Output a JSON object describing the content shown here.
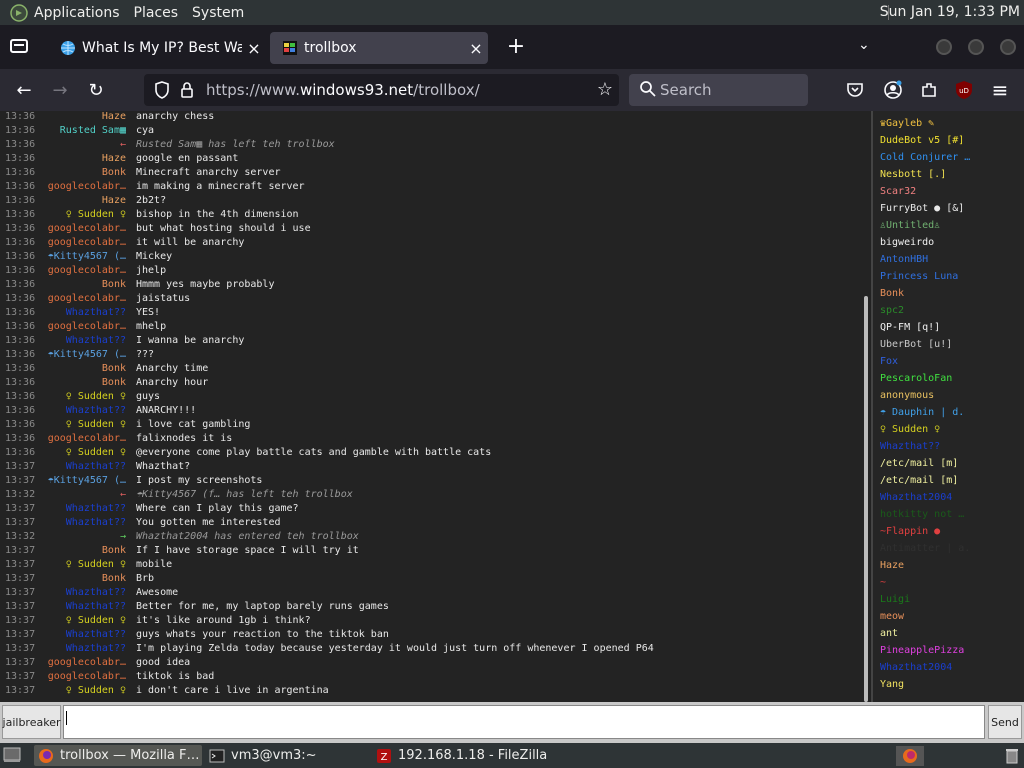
{
  "panel": {
    "menus": [
      "Applications",
      "Places",
      "System"
    ],
    "clock": "Sun Jan 19,  1:33 PM"
  },
  "tabs": [
    {
      "title": "What Is My IP? Best Way To",
      "close": "×"
    },
    {
      "title": "trollbox",
      "close": "×"
    }
  ],
  "newtab": "+",
  "alltabs": "⌄",
  "nav": {
    "back": "←",
    "forward": "→",
    "reload": "↻",
    "url_prefix": "https://www.",
    "url_domain": "windows93.net",
    "url_path": "/trollbox/",
    "search_placeholder": "Search",
    "menu": "≡"
  },
  "chat": {
    "messages": [
      {
        "time": "13:36",
        "nick": "Haze",
        "color": "#e8a060",
        "text": "anarchy chess"
      },
      {
        "time": "13:36",
        "nick": "Rusted Sam▦",
        "color": "#52d1c8",
        "text": "cya"
      },
      {
        "time": "13:36",
        "nick": "←",
        "color": "#e06060",
        "text": "Rusted Sam▦ has left teh trollbox",
        "sys": true
      },
      {
        "time": "13:36",
        "nick": "Haze",
        "color": "#e8a060",
        "text": "google en passant"
      },
      {
        "time": "13:36",
        "nick": "Bonk",
        "color": "#e8905a",
        "text": "Minecraft anarchy server"
      },
      {
        "time": "13:36",
        "nick": "googlecolabr…",
        "color": "#e07040",
        "text": "im making a minecraft server"
      },
      {
        "time": "13:36",
        "nick": "Haze",
        "color": "#e8a060",
        "text": "2b2t?"
      },
      {
        "time": "13:36",
        "nick": "♀ Sudden ♀",
        "color": "#d4d020",
        "text": "bishop in the 4th dimension"
      },
      {
        "time": "13:36",
        "nick": "googlecolabr…",
        "color": "#e07040",
        "text": "but what hosting should i use"
      },
      {
        "time": "13:36",
        "nick": "googlecolabr…",
        "color": "#e07040",
        "text": "it will be anarchy"
      },
      {
        "time": "13:36",
        "nick": "☂Kitty4567 (…",
        "color": "#5aa0e0",
        "text": "Mickey"
      },
      {
        "time": "13:36",
        "nick": "googlecolabr…",
        "color": "#e07040",
        "text": "jhelp"
      },
      {
        "time": "13:36",
        "nick": "Bonk",
        "color": "#e8905a",
        "text": "Hmmm yes maybe probably"
      },
      {
        "time": "13:36",
        "nick": "googlecolabr…",
        "color": "#e07040",
        "text": "jaistatus"
      },
      {
        "time": "13:36",
        "nick": "Whazthat??",
        "color": "#1a3fd0",
        "text": "YES!"
      },
      {
        "time": "13:36",
        "nick": "googlecolabr…",
        "color": "#e07040",
        "text": "mhelp"
      },
      {
        "time": "13:36",
        "nick": "Whazthat??",
        "color": "#1a3fd0",
        "text": "I wanna be anarchy"
      },
      {
        "time": "13:36",
        "nick": "☂Kitty4567 (…",
        "color": "#5aa0e0",
        "text": "???"
      },
      {
        "time": "13:36",
        "nick": "Bonk",
        "color": "#e8905a",
        "text": "Anarchy time"
      },
      {
        "time": "13:36",
        "nick": "Bonk",
        "color": "#e8905a",
        "text": "Anarchy hour"
      },
      {
        "time": "13:36",
        "nick": "♀ Sudden ♀",
        "color": "#d4d020",
        "text": "guys"
      },
      {
        "time": "13:36",
        "nick": "Whazthat??",
        "color": "#1a3fd0",
        "text": "ANARCHY!!!"
      },
      {
        "time": "13:36",
        "nick": "♀ Sudden ♀",
        "color": "#d4d020",
        "text": "i love cat gambling"
      },
      {
        "time": "13:36",
        "nick": "googlecolabr…",
        "color": "#e07040",
        "text": "falixnodes it is"
      },
      {
        "time": "13:36",
        "nick": "♀ Sudden ♀",
        "color": "#d4d020",
        "text": "@everyone come play battle cats and gamble with battle cats"
      },
      {
        "time": "13:37",
        "nick": "Whazthat??",
        "color": "#1a3fd0",
        "text": "Whazthat?"
      },
      {
        "time": "13:37",
        "nick": "☂Kitty4567 (…",
        "color": "#5aa0e0",
        "text": "I post my screenshots"
      },
      {
        "time": "13:32",
        "nick": "←",
        "color": "#e06060",
        "text": "☂Kitty4567 (f… has left teh trollbox",
        "sys": true
      },
      {
        "time": "13:37",
        "nick": "Whazthat??",
        "color": "#1a3fd0",
        "text": "Where can I play this game?"
      },
      {
        "time": "13:37",
        "nick": "Whazthat??",
        "color": "#1a3fd0",
        "text": "You gotten me interested"
      },
      {
        "time": "13:32",
        "nick": "→",
        "color": "#60d060",
        "text": "Whazthat2004 has entered teh trollbox",
        "sys": true
      },
      {
        "time": "13:37",
        "nick": "Bonk",
        "color": "#e8905a",
        "text": "If I have storage space I will try it"
      },
      {
        "time": "13:37",
        "nick": "♀ Sudden ♀",
        "color": "#d4d020",
        "text": "mobile"
      },
      {
        "time": "13:37",
        "nick": "Bonk",
        "color": "#e8905a",
        "text": "Brb"
      },
      {
        "time": "13:37",
        "nick": "Whazthat??",
        "color": "#1a3fd0",
        "text": "Awesome"
      },
      {
        "time": "13:37",
        "nick": "Whazthat??",
        "color": "#1a3fd0",
        "text": "Better for me, my laptop barely runs games"
      },
      {
        "time": "13:37",
        "nick": "♀ Sudden ♀",
        "color": "#d4d020",
        "text": "it's like around 1gb i think?"
      },
      {
        "time": "13:37",
        "nick": "Whazthat??",
        "color": "#1a3fd0",
        "text": "guys whats your reaction to the tiktok ban"
      },
      {
        "time": "13:37",
        "nick": "Whazthat??",
        "color": "#1a3fd0",
        "text": "I'm playing Zelda today because yesterday it would just turn off whenever I opened P64"
      },
      {
        "time": "13:37",
        "nick": "googlecolabr…",
        "color": "#e07040",
        "text": "good idea"
      },
      {
        "time": "13:37",
        "nick": "googlecolabr…",
        "color": "#e07040",
        "text": "tiktok is bad"
      },
      {
        "time": "13:37",
        "nick": "♀ Sudden ♀",
        "color": "#d4d020",
        "text": "i don't care i live in argentina"
      }
    ]
  },
  "users": [
    {
      "name": "♛Gayleb ✎",
      "color": "#f0c040"
    },
    {
      "name": "DudeBot v5 [#]",
      "color": "#f0e030"
    },
    {
      "name": "Cold Conjurer …",
      "color": "#3090f0"
    },
    {
      "name": "Nesbott [.]",
      "color": "#f0e050"
    },
    {
      "name": "Scar32",
      "color": "#f08080"
    },
    {
      "name": "FurryBot ● [&]",
      "color": "#e8e8e8"
    },
    {
      "name": "♙Untitled♙",
      "color": "#70b070"
    },
    {
      "name": "bigweirdo",
      "color": "#f0f0f0"
    },
    {
      "name": "AntonHBH",
      "color": "#3070e0"
    },
    {
      "name": "Princess Luna",
      "color": "#3070e0"
    },
    {
      "name": "Bonk",
      "color": "#e8905a"
    },
    {
      "name": "spc2",
      "color": "#2a8a2a"
    },
    {
      "name": "QP-FM [q!]",
      "color": "#f0f0f0"
    },
    {
      "name": "UberBot [u!]",
      "color": "#c8c8c8"
    },
    {
      "name": "Fox",
      "color": "#3060e0"
    },
    {
      "name": "PescaroloFan",
      "color": "#40e040"
    },
    {
      "name": "anonymous",
      "color": "#e8c060"
    },
    {
      "name": "☂ Dauphin | d.",
      "color": "#40a0e8"
    },
    {
      "name": "♀ Sudden ♀",
      "color": "#d4d020"
    },
    {
      "name": "Whazthat??",
      "color": "#1a3fd0"
    },
    {
      "name": "/etc/mail [m]",
      "color": "#f0f0a0"
    },
    {
      "name": "/etc/mail [m]",
      "color": "#f0f0a0"
    },
    {
      "name": "Whazthat2004",
      "color": "#1a3fd0"
    },
    {
      "name": "hotkitty not …",
      "color": "#1a5a1a"
    },
    {
      "name": "~Flappin ●",
      "color": "#e04040"
    },
    {
      "name": "Antimatter | a.",
      "color": "#303030"
    },
    {
      "name": "Haze",
      "color": "#e8a060"
    },
    {
      "name": "~",
      "color": "#e04040"
    },
    {
      "name": "Luigi",
      "color": "#1a7a1a"
    },
    {
      "name": "meow",
      "color": "#e8905a"
    },
    {
      "name": "ant",
      "color": "#f0f0a0"
    },
    {
      "name": "PineapplePizza",
      "color": "#e040e0"
    },
    {
      "name": "Whazthat2004",
      "color": "#1a3fd0"
    },
    {
      "name": "Yang",
      "color": "#f0e060"
    }
  ],
  "input": {
    "nick": "jailbreaker",
    "send": "Send"
  },
  "taskbar": [
    {
      "label": "trollbox — Mozilla F…",
      "icon": "firefox-icon"
    },
    {
      "label": "vm3@vm3:~",
      "icon": "terminal-icon"
    },
    {
      "label": "192.168.1.18 - FileZilla",
      "icon": "filezilla-icon"
    }
  ]
}
